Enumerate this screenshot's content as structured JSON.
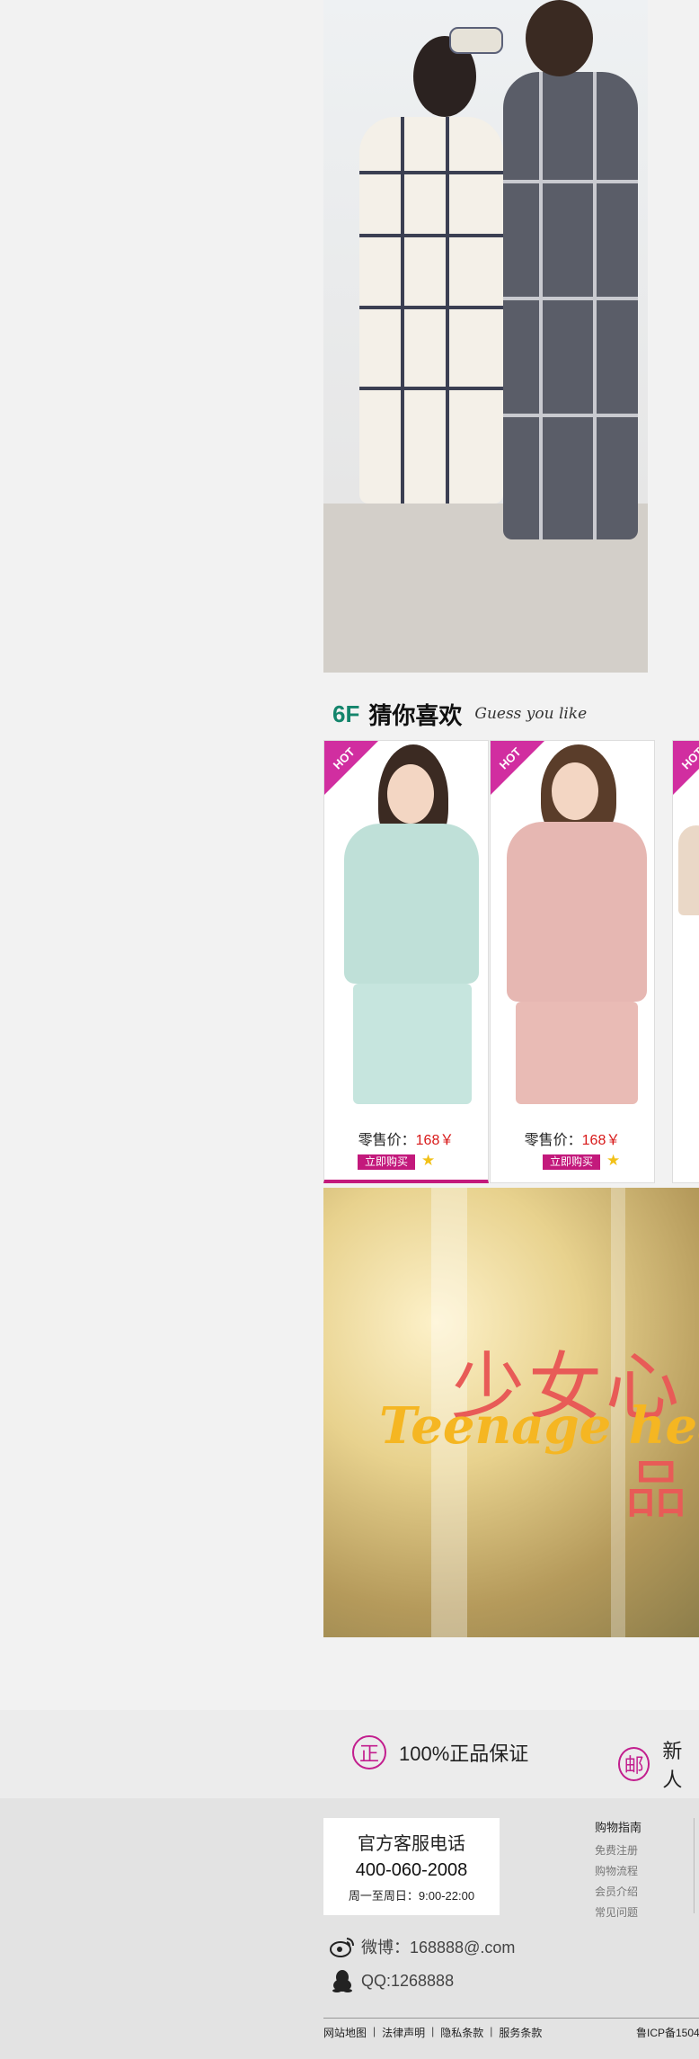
{
  "floor": {
    "number": "6F",
    "name": "猜你喜欢",
    "english": "Guess you like"
  },
  "products": [
    {
      "badge": "HOT",
      "price_label": "零售价：",
      "price": "168￥",
      "buy_label": "立即购买",
      "star_icon": "star-icon"
    },
    {
      "badge": "HOT",
      "price_label": "零售价：",
      "price": "168￥",
      "buy_label": "立即购买",
      "star_icon": "star-icon"
    },
    {
      "badge": "HOT"
    }
  ],
  "promo": {
    "title_cn": "少女心",
    "title_en": "Teenage heart",
    "title_cn_2": "品"
  },
  "guarantees": [
    {
      "icon": "正",
      "label": "100%正品保证"
    },
    {
      "icon": "邮",
      "label": "新人"
    }
  ],
  "footer": {
    "hotline_title": "官方客服电话",
    "hotline_number": "400-060-2008",
    "hotline_hours": "周一至周日：9:00-22:00",
    "guide_title": "购物指南",
    "guide_links": [
      "免费注册",
      "购物流程",
      "会员介绍",
      "常见问题"
    ],
    "weibo": "微博：168888@.com",
    "qq": "QQ:1268888",
    "bottom_links": [
      "网站地图",
      "法律声明",
      "隐私条款",
      "服务条款"
    ],
    "icp": "鲁ICP备1504"
  },
  "colors": {
    "accent": "#c3197c",
    "floor_green": "#14856c",
    "price_red": "#d81919",
    "star": "#f2c118"
  }
}
